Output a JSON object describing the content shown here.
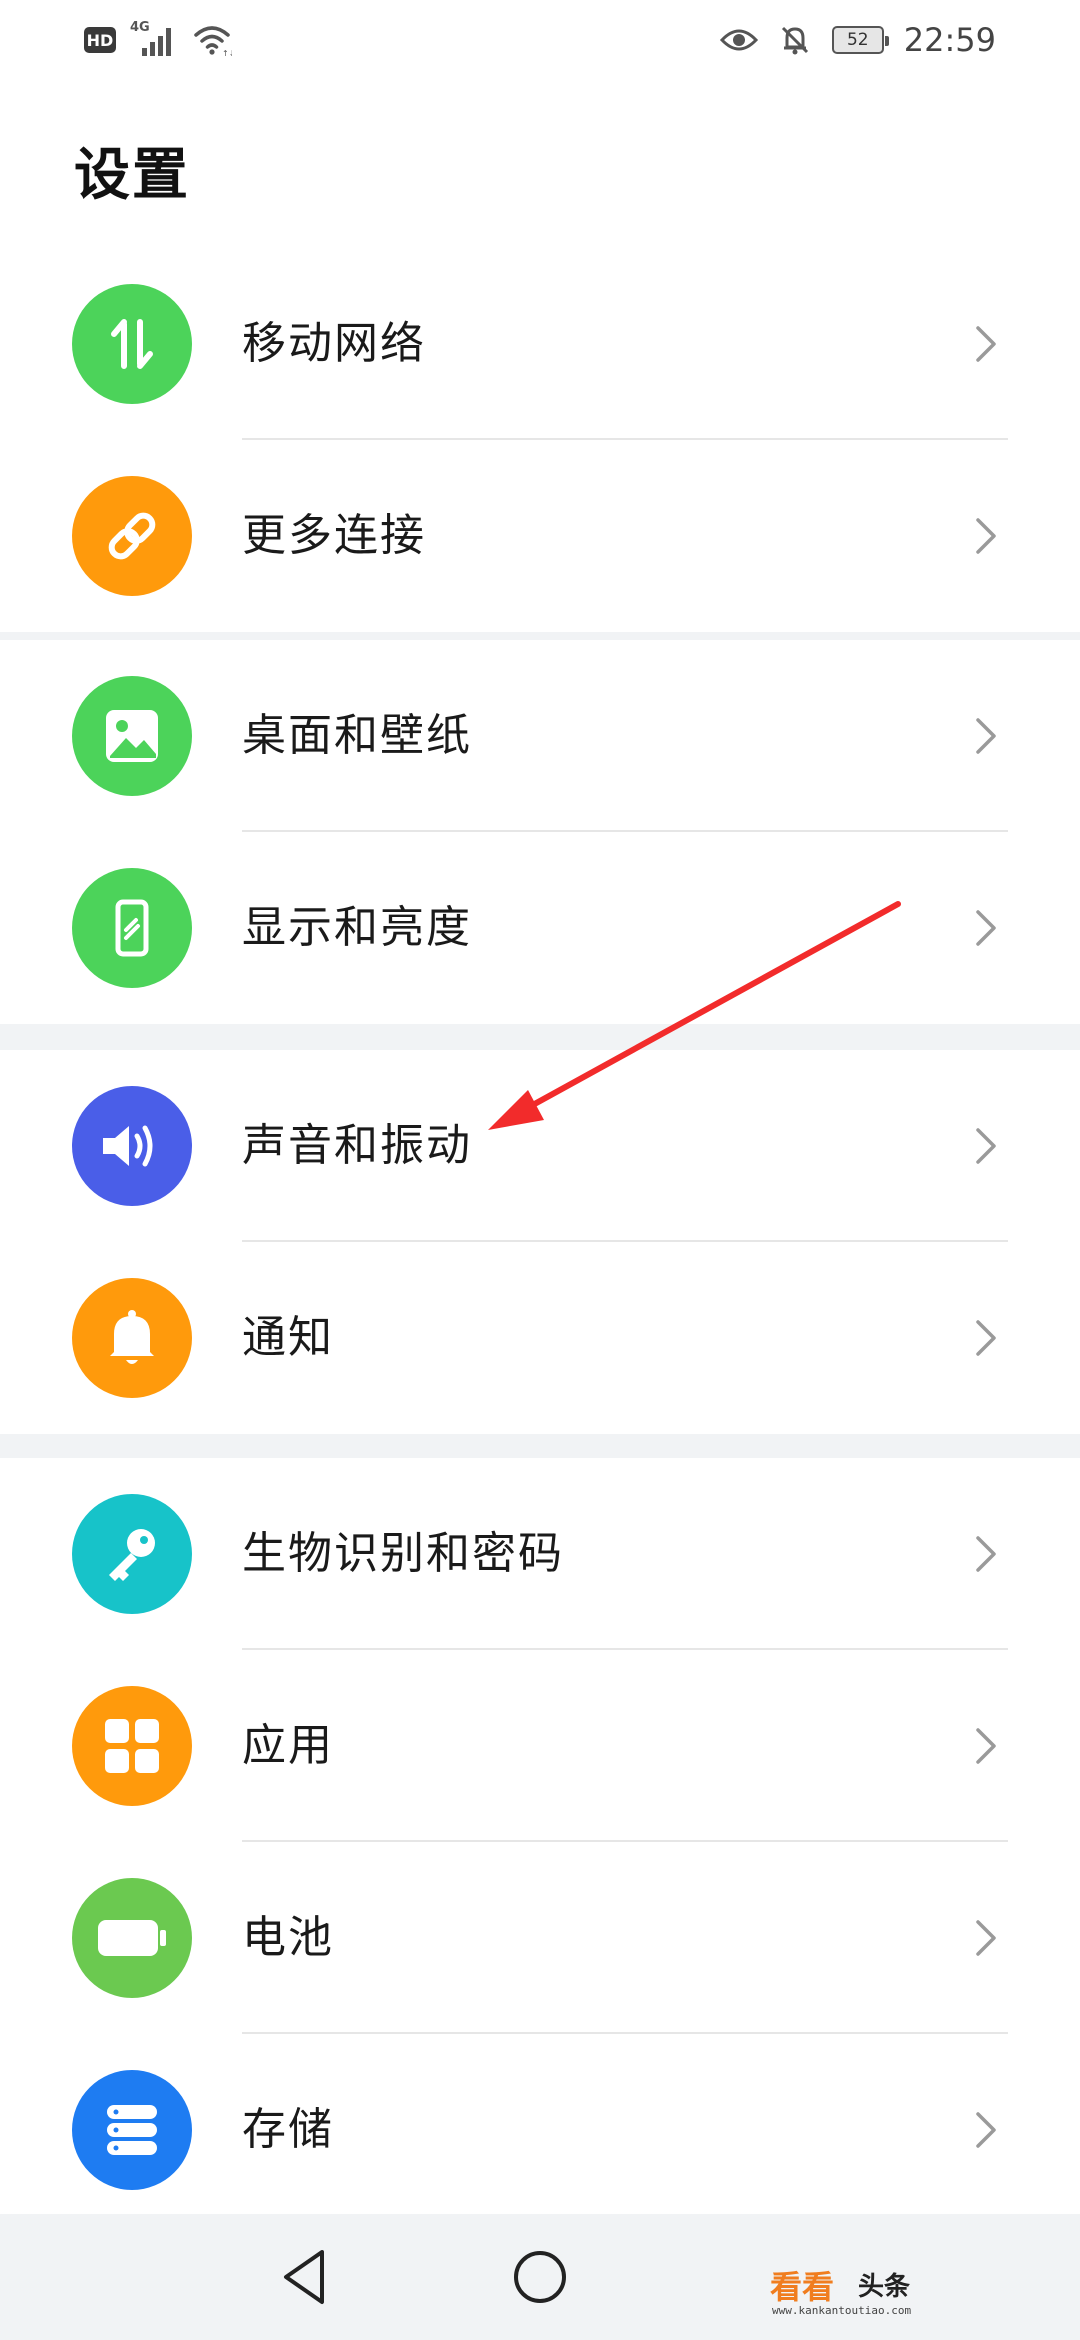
{
  "status": {
    "hd": "HD",
    "network": "4G",
    "battery": "52",
    "time": "22:59"
  },
  "page": {
    "title": "设置"
  },
  "groups": [
    {
      "items": [
        {
          "label": "移动网络",
          "icon": "mobile-network-icon",
          "color": "#4cd35a"
        },
        {
          "label": "更多连接",
          "icon": "link-icon",
          "color": "#ff9a0c"
        }
      ]
    },
    {
      "items": [
        {
          "label": "桌面和壁纸",
          "icon": "wallpaper-icon",
          "color": "#4cd35a"
        },
        {
          "label": "显示和亮度",
          "icon": "display-icon",
          "color": "#4cd35a"
        }
      ]
    },
    {
      "items": [
        {
          "label": "声音和振动",
          "icon": "speaker-icon",
          "color": "#4a5ee8"
        },
        {
          "label": "通知",
          "icon": "bell-icon",
          "color": "#ff9a0c"
        }
      ]
    },
    {
      "items": [
        {
          "label": "生物识别和密码",
          "icon": "key-icon",
          "color": "#17c3c9"
        },
        {
          "label": "应用",
          "icon": "apps-icon",
          "color": "#ff9a0c"
        },
        {
          "label": "电池",
          "icon": "battery-icon",
          "color": "#6bc950"
        },
        {
          "label": "存储",
          "icon": "storage-icon",
          "color": "#1e7cf2"
        }
      ]
    }
  ],
  "watermark": {
    "brand": "看看",
    "suffix": "头条",
    "url": "www.kankantoutiao.com"
  },
  "annotation": {
    "color": "#f22b2b"
  }
}
